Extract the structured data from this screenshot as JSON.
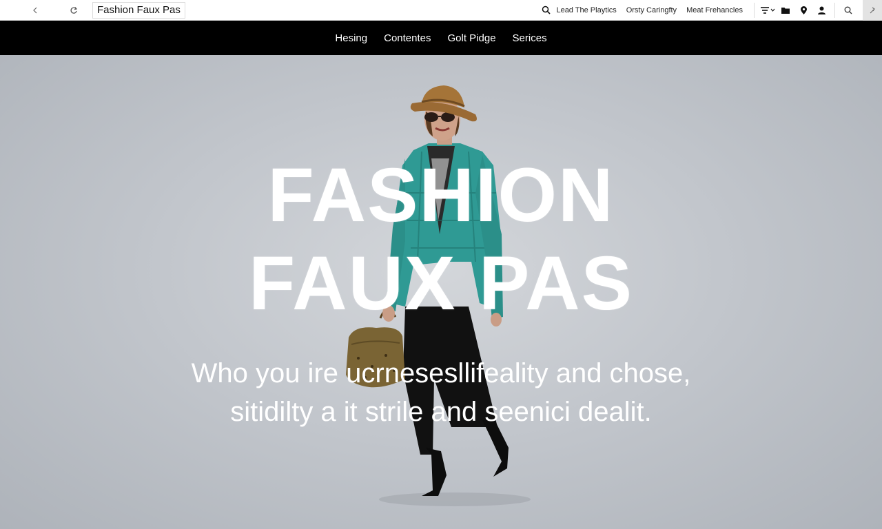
{
  "browser": {
    "title": "Fashion Faux Pas",
    "links": [
      "Lead The Playtics",
      "Orsty Caringfty",
      "Meat Frehancles"
    ],
    "icons": [
      "back-icon",
      "reload-icon",
      "search-icon",
      "filter-icon",
      "chevron-down-icon",
      "folder-icon",
      "pin-icon",
      "person-icon",
      "zoom-icon",
      "ext-icon"
    ]
  },
  "nav": {
    "items": [
      "Hesing",
      "Contentes",
      "Golt Pidge",
      "Serices"
    ]
  },
  "hero": {
    "title_line1": "FASHION",
    "title_line2": "FAUX PAS",
    "subtitle_line1": "Who you ire ucrnesesllifeality and chose,",
    "subtitle_line2": "sitidilty a it strile and seenici dealit."
  },
  "colors": {
    "nav_bg": "#000000",
    "hero_bg": "#c4c8cd",
    "jacket": "#2f9a94",
    "hat": "#9a6a34"
  }
}
